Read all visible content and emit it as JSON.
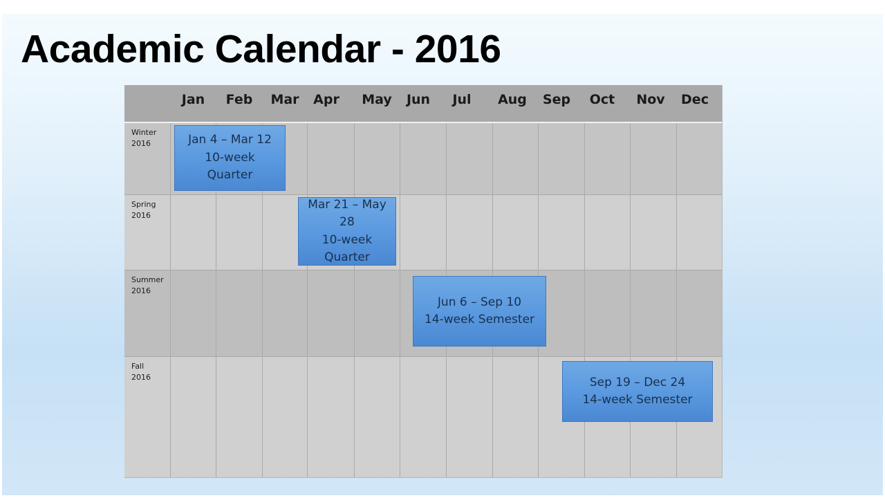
{
  "slide": {
    "title": "Academic Calendar - 2016"
  },
  "calendar": {
    "months": [
      "Jan",
      "Feb",
      "Mar",
      "Apr",
      "May",
      "Jun",
      "Jul",
      "Aug",
      "Sep",
      "Oct",
      "Nov",
      "Dec"
    ],
    "rows": [
      {
        "label": "Winter\n2016"
      },
      {
        "label": "Spring\n2016"
      },
      {
        "label": "Summer\n2016"
      },
      {
        "label": "Fall\n2016"
      }
    ],
    "terms": [
      {
        "lines": [
          "Jan 4 – Mar 12",
          "10-week",
          "Quarter"
        ],
        "start": "Jan 4",
        "end": "Mar 12",
        "length": "10-week",
        "type": "Quarter"
      },
      {
        "lines": [
          "Mar 21 – May",
          "28",
          "10-week",
          "Quarter"
        ],
        "start": "Mar 21",
        "end": "May 28",
        "length": "10-week",
        "type": "Quarter"
      },
      {
        "lines": [
          "Jun 6 – Sep 10",
          "14-week Semester"
        ],
        "start": "Jun 6",
        "end": "Sep 10",
        "length": "14-week",
        "type": "Semester"
      },
      {
        "lines": [
          "Sep 19 – Dec 24",
          "14-week Semester"
        ],
        "start": "Sep 19",
        "end": "Dec 24",
        "length": "14-week",
        "type": "Semester"
      }
    ],
    "colors": {
      "header": "#a9a9a9",
      "term_fill": "#5b9ae0",
      "term_text": "#17304f"
    }
  }
}
